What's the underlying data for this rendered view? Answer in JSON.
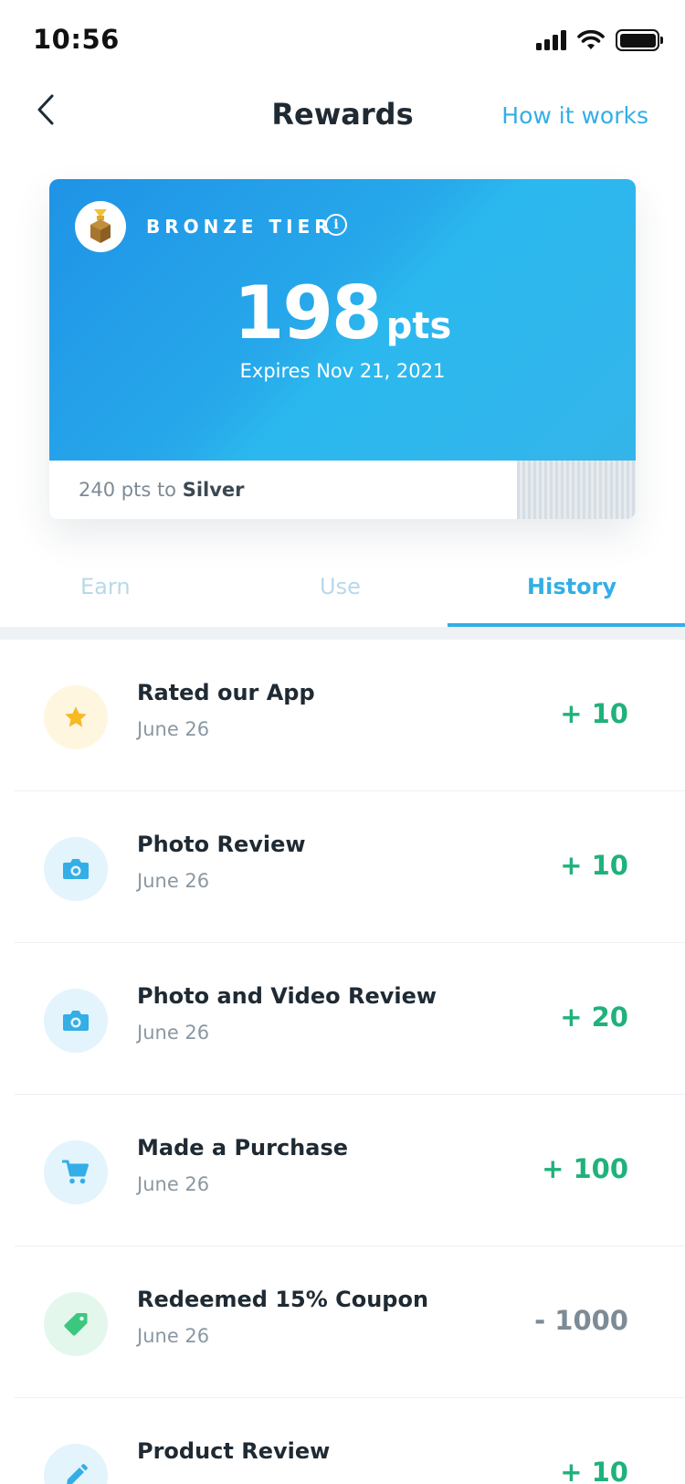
{
  "status_bar": {
    "time": "10:56"
  },
  "header": {
    "title": "Rewards",
    "how_it_works": "How it works"
  },
  "tier_card": {
    "tier": "BRONZE TIER",
    "points": "198",
    "points_unit": "pts",
    "expires": "Expires Nov 21, 2021",
    "progress_prefix": "240 pts to",
    "next_tier": "Silver"
  },
  "tabs": [
    {
      "label": "Earn"
    },
    {
      "label": "Use"
    },
    {
      "label": "History"
    }
  ],
  "active_tab": "History",
  "history": [
    {
      "title": "Rated our App",
      "date": "June 26",
      "points": "+ 10",
      "icon": "star-icon"
    },
    {
      "title": "Photo Review",
      "date": "June 26",
      "points": "+ 10",
      "icon": "camera-icon"
    },
    {
      "title": "Photo and Video Review",
      "date": "June 26",
      "points": "+ 20",
      "icon": "camera-icon"
    },
    {
      "title": "Made a Purchase",
      "date": "June 26",
      "points": "+ 100",
      "icon": "cart-icon"
    },
    {
      "title": "Redeemed 15% Coupon",
      "date": "June 26",
      "points": "- 1000",
      "icon": "tag-icon"
    },
    {
      "title": "Product Review",
      "date": "",
      "points": "+ 10",
      "icon": "pencil-icon"
    }
  ],
  "colors": {
    "accent": "#33aee6",
    "positive": "#1fb27a",
    "negative": "#7d8b96",
    "card_gradient_start": "#1f93e6",
    "card_gradient_end": "#34b5ea"
  }
}
